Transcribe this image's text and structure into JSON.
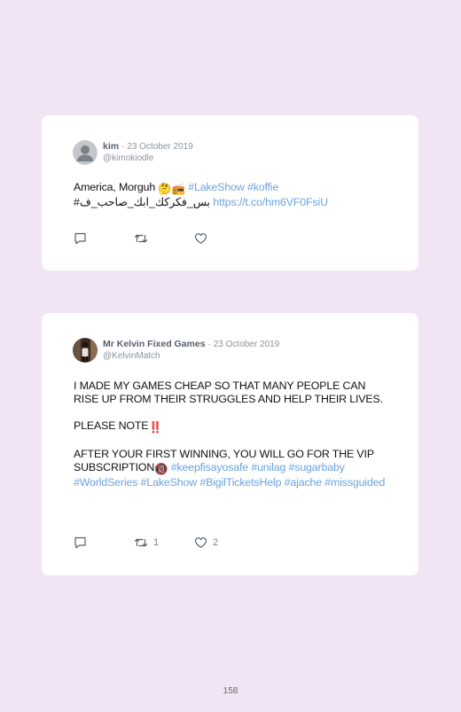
{
  "tweets": [
    {
      "name": "kim",
      "separator": "·",
      "date": "23 October 2019",
      "handle": "@kimokiodle",
      "text_plain": "America, Morguh",
      "emoji": "🤔📻",
      "tags": [
        "#LakeShow",
        "#koffie"
      ],
      "arabic_tag": "#بس_فكركك_ابك_صاحب_ف",
      "link": "https://t.co/hm6VF0FsiU",
      "reply_count": "",
      "retweet_count": "",
      "like_count": "",
      "avatar": "default-avatar-icon"
    },
    {
      "name": "Mr Kelvin Fixed Games",
      "separator": "·",
      "date": "23 October 2019",
      "handle": "@KelvinMatch",
      "para1": "I MADE MY GAMES CHEAP SO THAT MANY PEOPLE CAN RISE UP FROM THEIR STRUGGLES AND HELP THEIR LIVES.",
      "para2": "PLEASE NOTE",
      "para2_emoji": "‼️",
      "para3_plain": "AFTER YOUR FIRST WINNING, YOU WILL GO FOR THE VIP SUBSCRIPTION",
      "para3_emoji": "🔞",
      "para3_tags": "#keepfisayosafe #unilag #sugarbaby #WorldSeries #LakeShow #BigilTicketsHelp #ajache #missguided",
      "reply_count": "",
      "retweet_count": "1",
      "like_count": "2",
      "avatar": "user-photo"
    }
  ],
  "page": {
    "number": "158"
  }
}
